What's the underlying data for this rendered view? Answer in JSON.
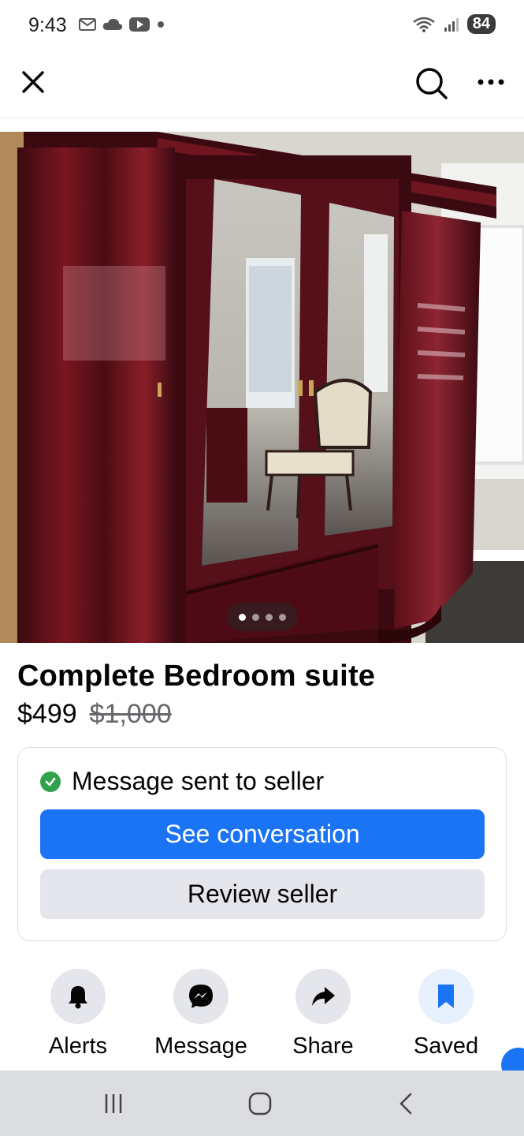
{
  "status_bar": {
    "time": "9:43",
    "battery": "84",
    "icons_left": [
      "mail-icon",
      "cloud-icon",
      "youtube-icon",
      "dot-icon"
    ],
    "icons_right": [
      "wifi-5-icon",
      "signal-icon",
      "battery-icon"
    ]
  },
  "top_nav": {
    "icons": [
      "close-icon",
      "search-icon",
      "more-icon"
    ]
  },
  "photo": {
    "carousel_total": 4,
    "carousel_active": 1
  },
  "listing": {
    "title": "Complete Bedroom suite",
    "price": "$499",
    "original_price": "$1,000"
  },
  "message_card": {
    "status": "Message sent to seller",
    "primary_button": "See conversation",
    "secondary_button": "Review seller"
  },
  "actions": [
    {
      "label": "Alerts",
      "icon": "bell-icon"
    },
    {
      "label": "Message",
      "icon": "messenger-icon"
    },
    {
      "label": "Share",
      "icon": "share-arrow-icon"
    },
    {
      "label": "Saved",
      "icon": "bookmark-icon"
    }
  ],
  "colors": {
    "primary": "#1b74f4",
    "secondary_bg": "#e4e6eb",
    "success": "#31a24c",
    "muted": "#65676b"
  },
  "system_nav": {
    "icons": [
      "recents-icon",
      "home-icon",
      "back-icon"
    ]
  }
}
